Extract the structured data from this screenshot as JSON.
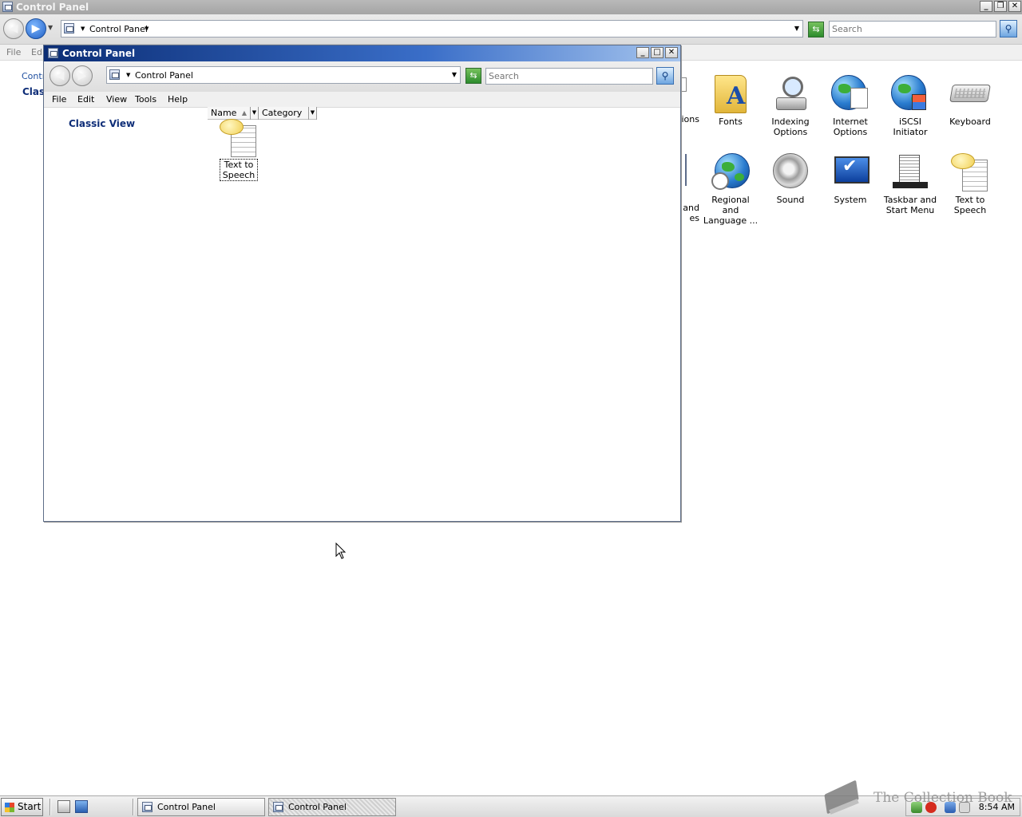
{
  "background_window": {
    "title": "Control Panel",
    "address": "Control Panel",
    "search_placeholder": "Search",
    "menu": {
      "file": "File",
      "edit_partial": "Edi"
    },
    "left_pane": {
      "link_partial": "Contr",
      "classic_partial": "Class"
    },
    "items": [
      {
        "label": "tions",
        "icon": "partial-icon"
      },
      {
        "label": "Fonts",
        "icon": "fonts-folder-icon"
      },
      {
        "label": "Indexing Options",
        "icon": "indexing-options-icon"
      },
      {
        "label": "Internet Options",
        "icon": "internet-options-icon"
      },
      {
        "label": "iSCSI Initiator",
        "icon": "iscsi-initiator-icon"
      },
      {
        "label": "Keyboard",
        "icon": "keyboard-icon"
      },
      {
        "label": "and\nes",
        "icon": "partial-icon"
      },
      {
        "label": "Regional and Language ...",
        "icon": "regional-language-icon"
      },
      {
        "label": "Sound",
        "icon": "sound-icon"
      },
      {
        "label": "System",
        "icon": "system-icon"
      },
      {
        "label": "Taskbar and Start Menu",
        "icon": "taskbar-start-menu-icon"
      },
      {
        "label": "Text to Speech",
        "icon": "text-to-speech-icon"
      }
    ]
  },
  "foreground_window": {
    "title": "Control Panel",
    "address": "Control Panel",
    "search_placeholder": "Search",
    "menu": {
      "file": "File",
      "edit": "Edit",
      "view": "View",
      "tools": "Tools",
      "help": "Help"
    },
    "left_pane": {
      "classic_view": "Classic View"
    },
    "columns": {
      "name": "Name",
      "category": "Category"
    },
    "item": {
      "label": "Text to Speech",
      "icon": "text-to-speech-icon"
    }
  },
  "caption_buttons": {
    "minimize": "_",
    "restore": "❐",
    "maximize": "□",
    "close": "✕"
  },
  "taskbar": {
    "start_label": "Start",
    "tasks": [
      {
        "label": "Control Panel",
        "active": false
      },
      {
        "label": "Control Panel",
        "active": true
      }
    ],
    "clock": "8:54 AM"
  },
  "watermark": {
    "text": "The Collection Book"
  }
}
